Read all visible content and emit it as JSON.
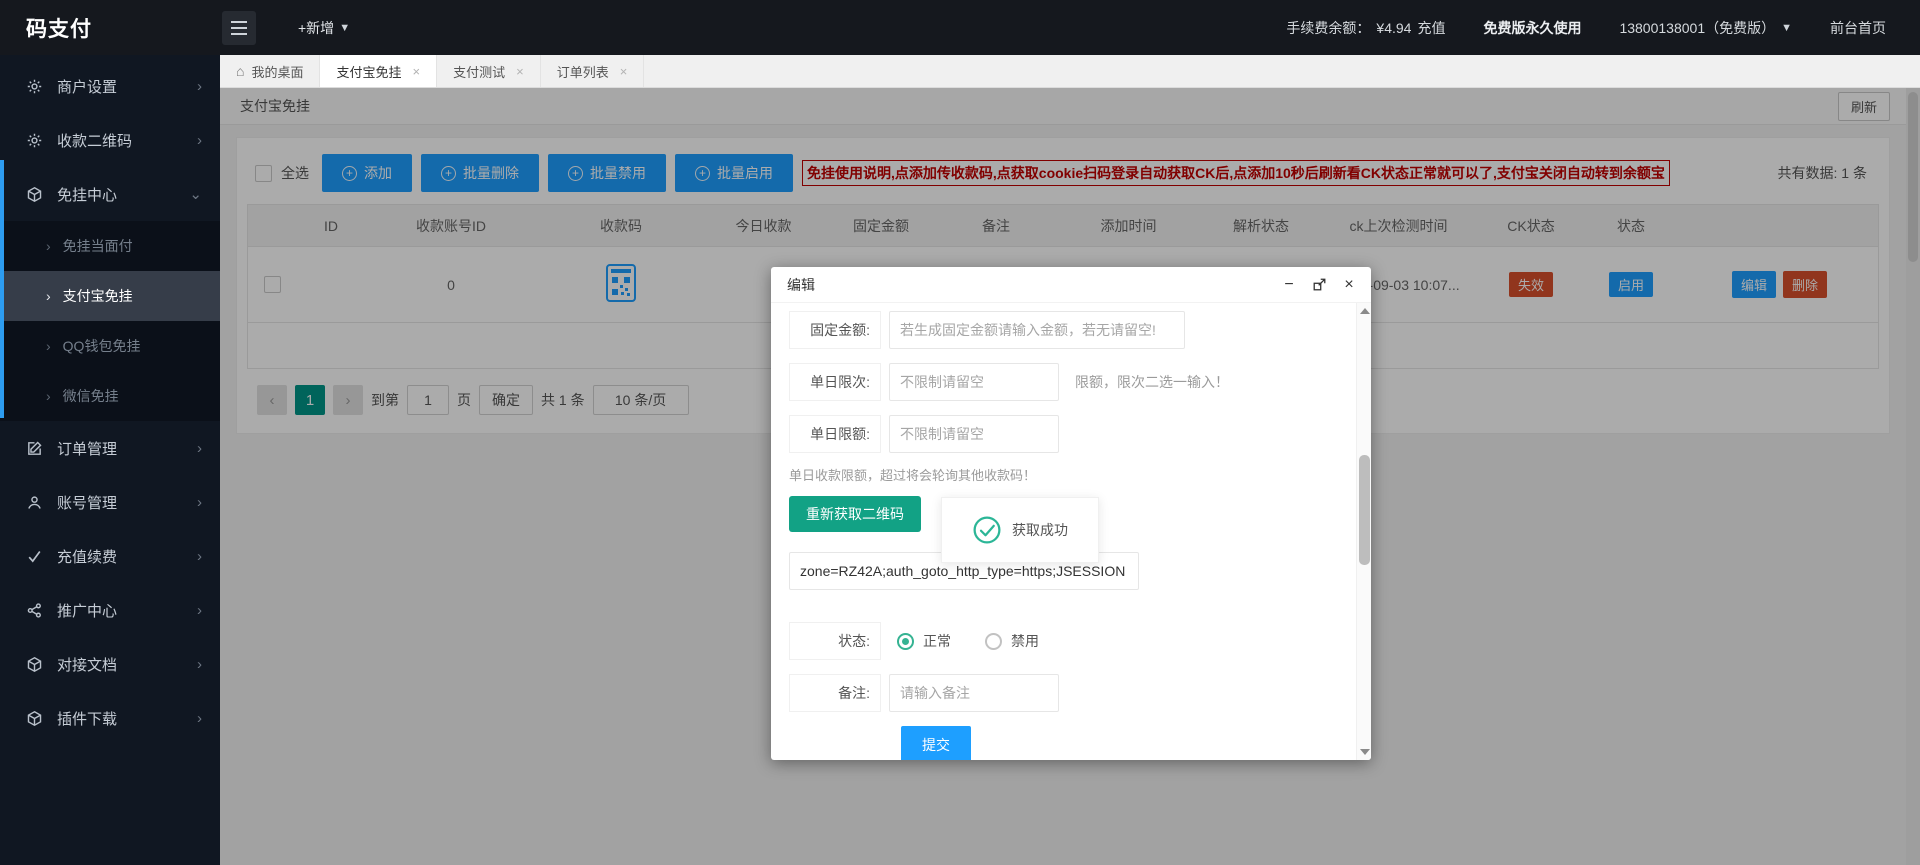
{
  "colors": {
    "accent_blue": "#1E9FFF",
    "danger_red": "#d9502c",
    "button_green": "#12A285",
    "pager_green": "#009688",
    "warning_red": "#c00000",
    "topbar_bg": "#15181e",
    "sidebar_bg": "#101722"
  },
  "topbar": {
    "logo": "码支付",
    "new_label": "+新增",
    "fee_label": "手续费余额：",
    "fee_value": "¥4.94",
    "recharge": "充值",
    "version_text": "免费版永久使用",
    "account": "13800138001（免费版）",
    "home": "前台首页"
  },
  "sidebar": {
    "items": [
      {
        "label": "商户设置",
        "icon": "gear-icon"
      },
      {
        "label": "收款二维码",
        "icon": "gear-icon"
      },
      {
        "label": "免挂中心",
        "icon": "cube-icon",
        "children": [
          "免挂当面付",
          "支付宝免挂",
          "QQ钱包免挂",
          "微信免挂"
        ],
        "active_child": "支付宝免挂"
      },
      {
        "label": "订单管理",
        "icon": "edit-icon"
      },
      {
        "label": "账号管理",
        "icon": "user-icon"
      },
      {
        "label": "充值续费",
        "icon": "check-icon"
      },
      {
        "label": "推广中心",
        "icon": "share-icon"
      },
      {
        "label": "对接文档",
        "icon": "cube-icon"
      },
      {
        "label": "插件下载",
        "icon": "cube-icon"
      }
    ]
  },
  "tabs": [
    "我的桌面",
    "支付宝免挂",
    "支付测试",
    "订单列表"
  ],
  "page": {
    "title": "支付宝免挂",
    "refresh": "刷新"
  },
  "toolbar": {
    "select_all": "全选",
    "add": "添加",
    "batch_delete": "批量删除",
    "batch_disable": "批量禁用",
    "batch_enable": "批量启用",
    "warning": "免挂使用说明,点添加传收款码,点获取cookie扫码登录自动获取CK后,点添加10秒后刷新看CK状态正常就可以了,支付宝关闭自动转到余额宝",
    "total": "共有数据: 1 条"
  },
  "table": {
    "headers": [
      "ID",
      "收款账号ID",
      "收款码",
      "今日收款",
      "固定金额",
      "备注",
      "添加时间",
      "解析状态",
      "ck上次检测时间",
      "CK状态",
      "状态"
    ],
    "row": {
      "account_id": "0",
      "ck_last_check": "2022-09-03 10:07...",
      "ck_status": "失效",
      "enable_status": "启用",
      "edit": "编辑",
      "delete": "删除"
    }
  },
  "pagination": {
    "prev": "‹",
    "current": "1",
    "next": "›",
    "goto_prefix": "到第",
    "goto_value": "1",
    "goto_suffix": "页",
    "confirm": "确定",
    "total": "共 1 条",
    "page_size": "10 条/页"
  },
  "modal": {
    "title": "编辑",
    "rows": [
      {
        "label": "固定金额:",
        "placeholder": "若生成固定金额请输入金额，若无请留空!"
      },
      {
        "label": "单日限次:",
        "placeholder": "不限制请留空",
        "hint": "限额，限次二选一输入！"
      },
      {
        "label": "单日限额:",
        "placeholder": "不限制请留空"
      }
    ],
    "note": "单日收款限额，超过将会轮询其他收款码！",
    "qr_button": "重新获取二维码",
    "toast": "获取成功",
    "cookie_value": "zone=RZ42A;auth_goto_http_type=https;JSESSION",
    "status_label": "状态:",
    "status_options": [
      "正常",
      "禁用"
    ],
    "remark_label": "备注:",
    "remark_placeholder": "请输入备注",
    "submit": "提交"
  }
}
